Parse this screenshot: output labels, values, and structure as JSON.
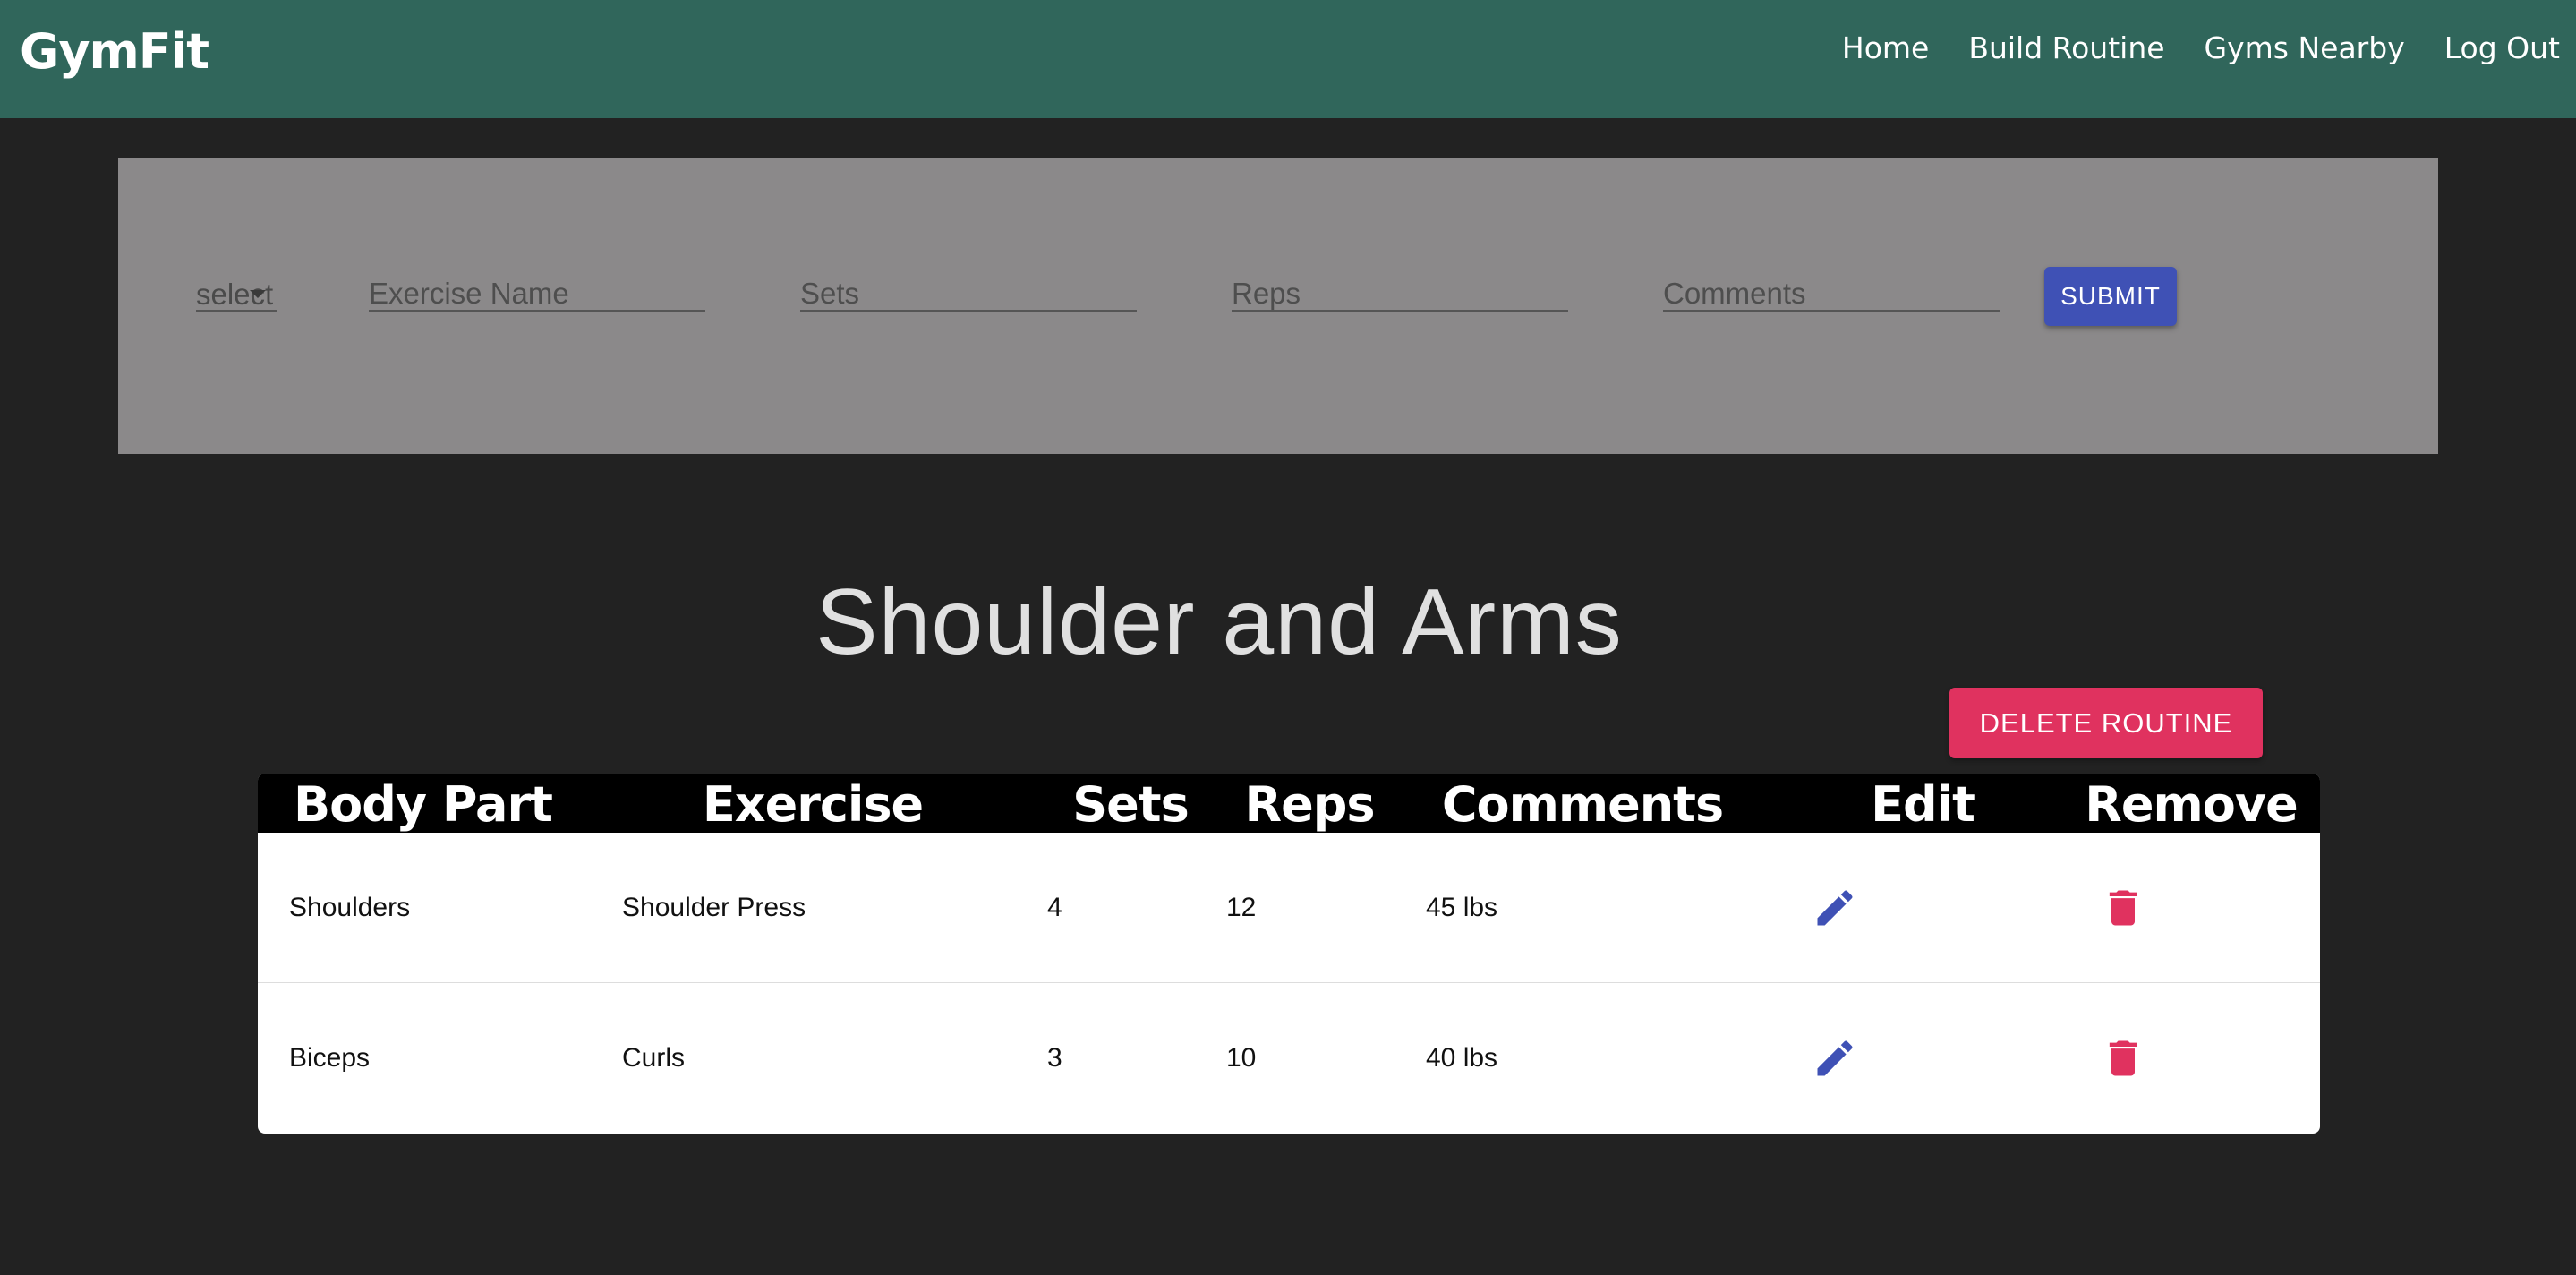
{
  "app": {
    "brand": "GymFit"
  },
  "nav": {
    "items": [
      {
        "label": "Home"
      },
      {
        "label": "Build Routine"
      },
      {
        "label": "Gyms Nearby"
      },
      {
        "label": "Log Out"
      }
    ]
  },
  "form": {
    "body_part_select": {
      "value": "select"
    },
    "exercise_name": {
      "placeholder": "Exercise Name",
      "value": ""
    },
    "sets": {
      "placeholder": "Sets",
      "value": ""
    },
    "reps": {
      "placeholder": "Reps",
      "value": ""
    },
    "comments": {
      "placeholder": "Comments",
      "value": ""
    },
    "submit_label": "SUBMIT"
  },
  "routine": {
    "title": "Shoulder and Arms",
    "delete_label": "DELETE ROUTINE"
  },
  "table": {
    "headers": {
      "body_part": "Body Part",
      "exercise": "Exercise",
      "sets": "Sets",
      "reps": "Reps",
      "comments": "Comments",
      "edit": "Edit",
      "remove": "Remove"
    },
    "rows": [
      {
        "body_part": "Shoulders",
        "exercise": "Shoulder Press",
        "sets": "4",
        "reps": "12",
        "comments": "45 lbs",
        "edit_icon": "pencil-icon",
        "remove_icon": "trash-icon"
      },
      {
        "body_part": "Biceps",
        "exercise": "Curls",
        "sets": "3",
        "reps": "10",
        "comments": "40 lbs",
        "edit_icon": "pencil-icon",
        "remove_icon": "trash-icon"
      }
    ]
  },
  "colors": {
    "navbar": "#30665b",
    "page_background": "#222222",
    "form_panel": "#8b898a",
    "primary_button": "#3f51b5",
    "danger_button": "#e0325f",
    "edit_icon": "#3f51b5",
    "remove_icon": "#e0325f",
    "table_header": "#000000"
  }
}
